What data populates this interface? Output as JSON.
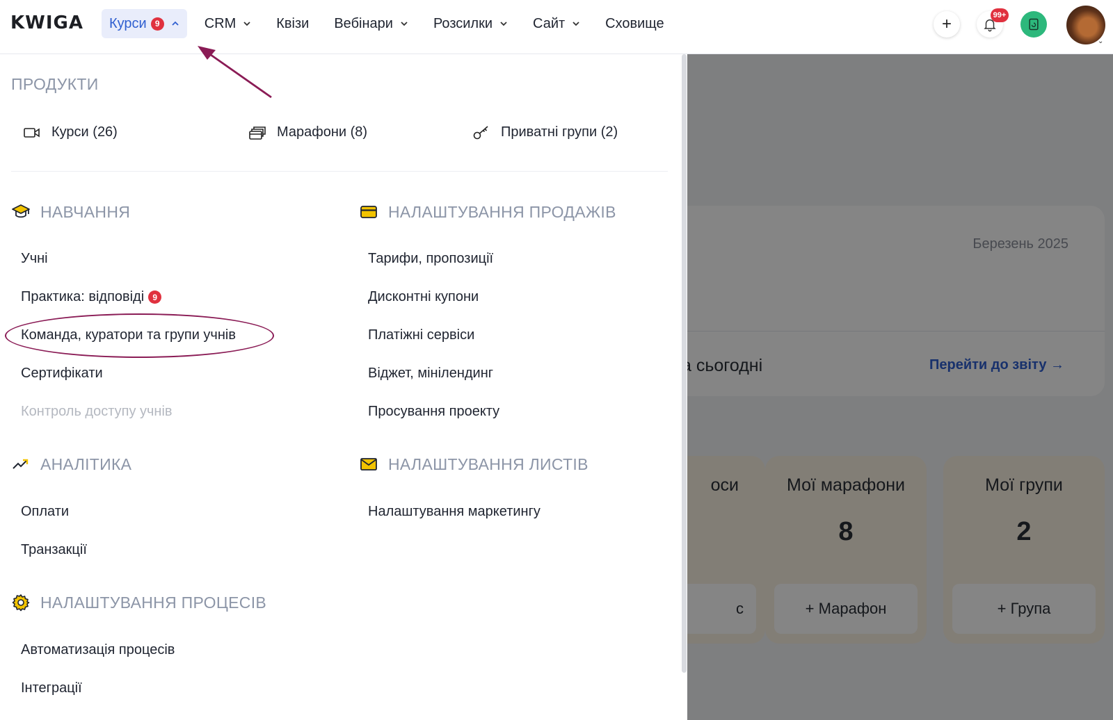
{
  "app": {
    "logo": "KWIGA"
  },
  "nav": {
    "items": [
      {
        "label": "Курси",
        "badge": "9",
        "has_chevron": true,
        "active": true
      },
      {
        "label": "CRM",
        "has_chevron": true
      },
      {
        "label": "Квізи",
        "has_chevron": false
      },
      {
        "label": "Вебінари",
        "has_chevron": true
      },
      {
        "label": "Розсилки",
        "has_chevron": true
      },
      {
        "label": "Сайт",
        "has_chevron": true
      },
      {
        "label": "Сховище",
        "has_chevron": false
      }
    ]
  },
  "top_actions": {
    "plus": "+",
    "notifications_badge": "99+"
  },
  "menu": {
    "products": {
      "heading": "ПРОДУКТИ",
      "items": [
        {
          "label": "Курси (26)",
          "icon": "video-icon"
        },
        {
          "label": "Марафони (8)",
          "icon": "cards-icon"
        },
        {
          "label": "Приватні групи (2)",
          "icon": "key-icon"
        }
      ]
    },
    "learning": {
      "heading": "НАВЧАННЯ",
      "icon": "graduation-cap-icon",
      "items": [
        {
          "label": "Учні"
        },
        {
          "label": "Практика: відповіді",
          "badge": "9"
        },
        {
          "label": "Команда, куратори та групи учнів",
          "highlighted": true
        },
        {
          "label": "Сертифікати"
        },
        {
          "label": "Контроль доступу учнів",
          "disabled": true
        }
      ]
    },
    "sales": {
      "heading": "НАЛАШТУВАННЯ ПРОДАЖІВ",
      "icon": "credit-card-icon",
      "items": [
        {
          "label": "Тарифи, пропозиції"
        },
        {
          "label": "Дисконтні купони"
        },
        {
          "label": "Платіжні сервіси"
        },
        {
          "label": "Віджет, мінілендинг"
        },
        {
          "label": "Просування проекту"
        }
      ]
    },
    "analytics": {
      "heading": "АНАЛІТИКА",
      "icon": "trending-up-icon",
      "items": [
        {
          "label": "Оплати"
        },
        {
          "label": "Транзакції"
        }
      ]
    },
    "letters": {
      "heading": "НАЛАШТУВАННЯ ЛИСТІВ",
      "icon": "envelope-icon",
      "items": [
        {
          "label": "Налаштування маркетингу"
        }
      ]
    },
    "processes": {
      "heading": "НАЛАШТУВАННЯ ПРОЦЕСІВ",
      "icon": "gear-icon",
      "items": [
        {
          "label": "Автоматизація процесів"
        },
        {
          "label": "Інтеграції"
        }
      ]
    }
  },
  "background": {
    "month": "Березень 2025",
    "today_fragment": "а сьогодні",
    "report_link": "Перейти до звіту →",
    "cards": [
      {
        "title": "оси",
        "number": "",
        "button": "с"
      },
      {
        "title": "Мої марафони",
        "number": "8",
        "button": "+ Марафон"
      },
      {
        "title": "Мої групи",
        "number": "2",
        "button": "+ Група"
      }
    ]
  },
  "colors": {
    "accent": "#2f5fd0",
    "badge": "#e0313f",
    "annotation": "#8a1b55",
    "section_heading": "#8c95a7",
    "icon_yellow": "#f2c300"
  }
}
